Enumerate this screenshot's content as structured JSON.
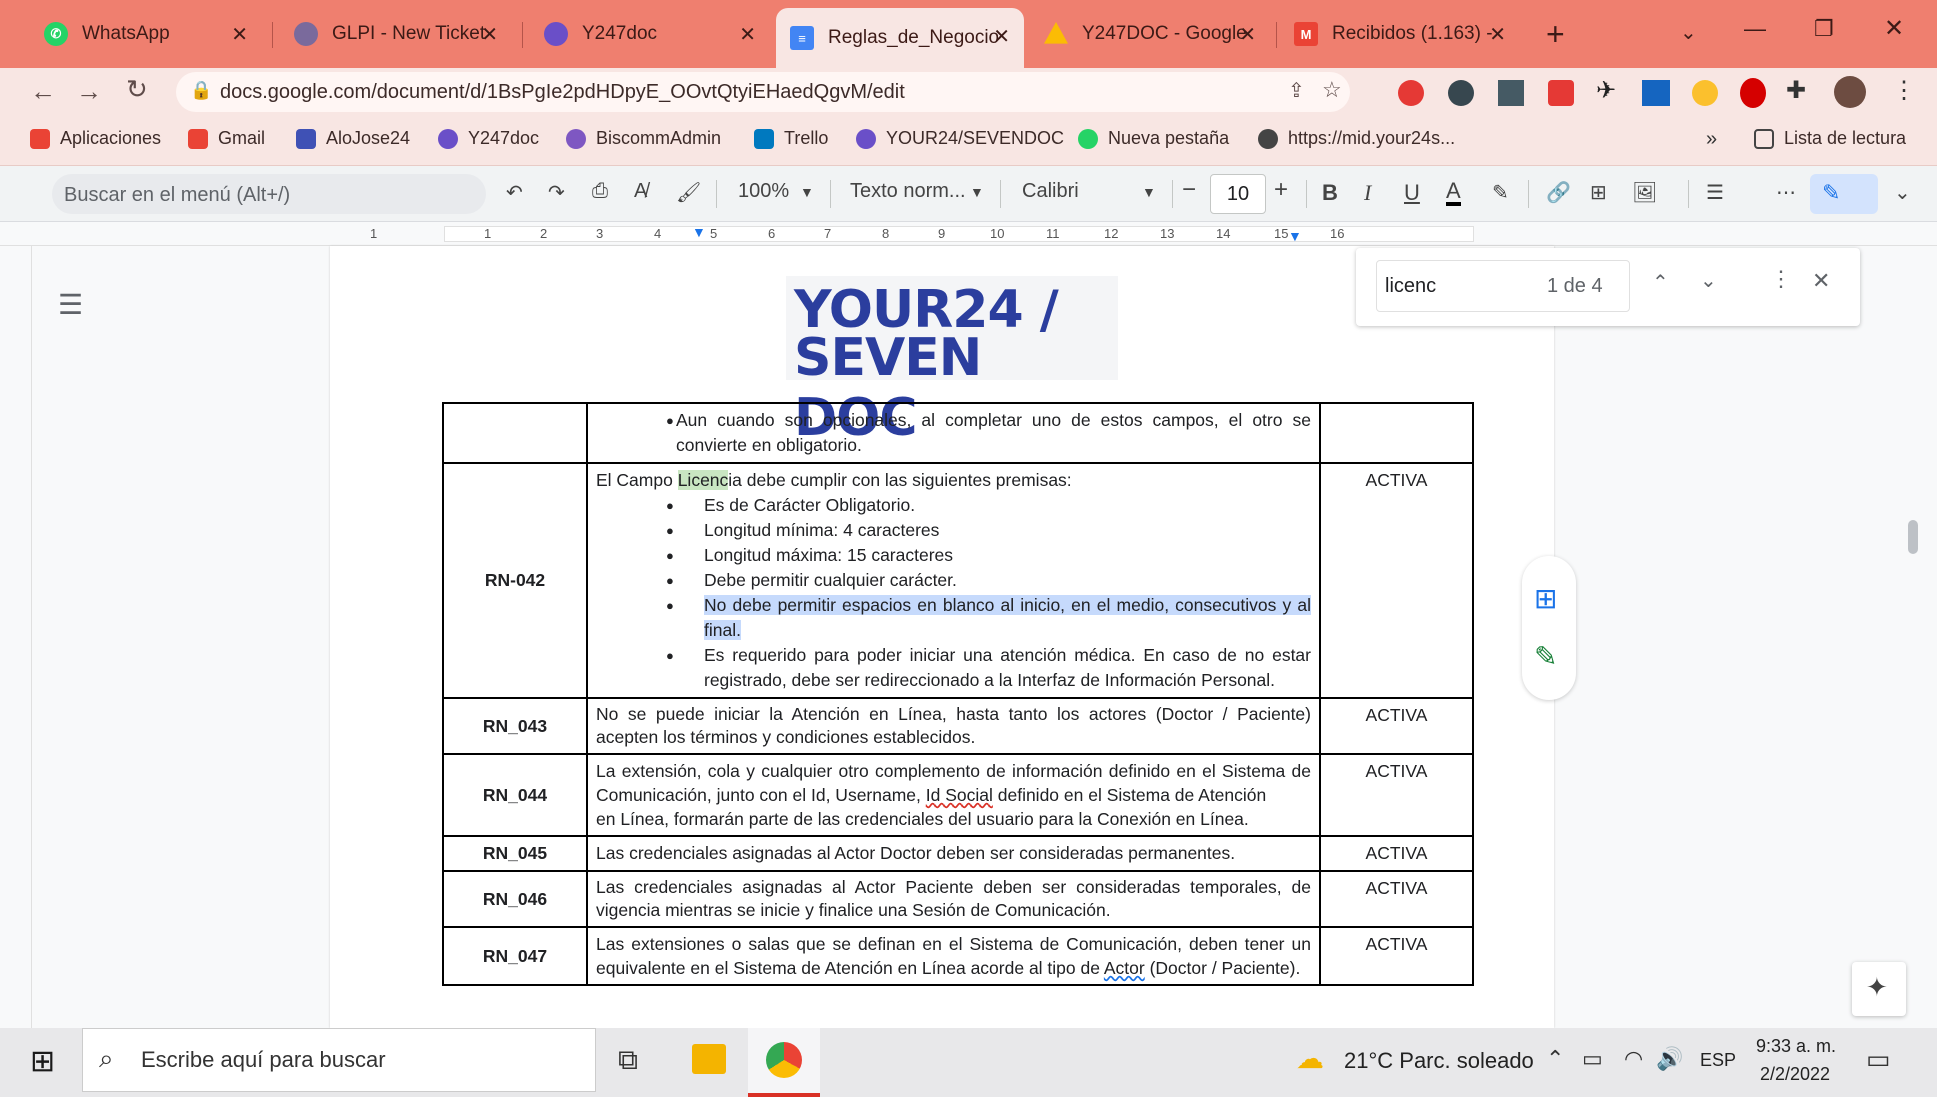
{
  "browser": {
    "tabs": [
      {
        "label": "WhatsApp",
        "icon": "whatsapp-icon",
        "color": "#25d366"
      },
      {
        "label": "GLPI - New Ticket",
        "icon": "glpi-icon",
        "color": "#7a6a9c"
      },
      {
        "label": "Y247doc",
        "icon": "y247-icon",
        "color": "#6a4fc8"
      },
      {
        "label": "Reglas_de_Negocio",
        "icon": "google-docs-icon",
        "color": "#4285f4"
      },
      {
        "label": "Y247DOC - Google",
        "icon": "google-drive-icon",
        "color": "#fbbc04"
      },
      {
        "label": "Recibidos (1.163) -",
        "icon": "gmail-icon",
        "color": "#ea4335"
      }
    ],
    "url": "docs.google.com/document/d/1BsPgIe2pdHDpyE_OOvtQtyiEHaedQgvM/edit",
    "bookmarks": [
      {
        "label": "Aplicaciones",
        "icon": "apps-grid-icon",
        "color": "#ea4335"
      },
      {
        "label": "Gmail",
        "icon": "gmail-icon",
        "color": "#ea4335"
      },
      {
        "label": "AloJose24",
        "icon": "alojose-icon",
        "color": "#3f51b5"
      },
      {
        "label": "Y247doc",
        "icon": "y247-icon",
        "color": "#6a4fc8"
      },
      {
        "label": "BiscommAdmin",
        "icon": "biscomm-icon",
        "color": "#7e57c2"
      },
      {
        "label": "Trello",
        "icon": "trello-icon",
        "color": "#0079bf"
      },
      {
        "label": "YOUR24/SEVENDOC",
        "icon": "y247-icon",
        "color": "#6a4fc8"
      },
      {
        "label": "Nueva pestaña",
        "icon": "whatsapp-icon",
        "color": "#25d366"
      },
      {
        "label": "https://mid.your24s...",
        "icon": "globe-icon",
        "color": "#444"
      }
    ],
    "reading_list": "Lista de lectura"
  },
  "docs_toolbar": {
    "menu_search_placeholder": "Buscar en el menú (Alt+/)",
    "zoom": "100%",
    "style": "Texto norm...",
    "font": "Calibri",
    "font_size": "10"
  },
  "ruler": [
    "1",
    "1",
    "2",
    "3",
    "4",
    "5",
    "6",
    "7",
    "8",
    "9",
    "10",
    "11",
    "12",
    "13",
    "14",
    "15",
    "16"
  ],
  "find": {
    "query": "licenc",
    "count": "1 de 4"
  },
  "logo": {
    "line1": "YOUR24 /",
    "line2": "SEVEN DOC"
  },
  "table": {
    "row0": {
      "bullet": "Aun cuando son opcionales, al completar uno de estos campos, el otro se convierte en obligatorio."
    },
    "row1": {
      "id": "RN-042",
      "intro_pre": "El Campo ",
      "intro_match": "Licenc",
      "intro_post": "ia debe cumplir con las siguientes premisas:",
      "bullets": [
        "Es de Carácter Obligatorio.",
        "Longitud mínima: 4 caracteres",
        "Longitud máxima: 15 caracteres",
        "Debe permitir cualquier carácter."
      ],
      "selected": "No debe permitir espacios en blanco al inicio, en el medio, consecutivos y al final.",
      "last": "Es requerido para poder iniciar una atención médica. En caso de no estar registrado, debe ser redireccionado a la Interfaz de Información Personal.",
      "status": "ACTIVA"
    },
    "row2": {
      "id": "RN_043",
      "text": "No se puede iniciar la Atención en Línea, hasta tanto los actores (Doctor / Paciente) acepten los términos y condiciones establecidos.",
      "status": "ACTIVA"
    },
    "row3": {
      "id": "RN_044",
      "pre": "La extensión, cola y cualquier otro complemento de información definido en el Sistema de Comunicación, junto con el Id, Username, ",
      "squig": "Id Social",
      "post": " definido en el Sistema de Atención",
      "line2": "en Línea, formarán parte de las credenciales del usuario para la Conexión en Línea.",
      "status": "ACTIVA"
    },
    "row4": {
      "id": "RN_045",
      "text": "Las credenciales asignadas al Actor Doctor deben ser consideradas permanentes.",
      "status": "ACTIVA"
    },
    "row5": {
      "id": "RN_046",
      "text": "Las credenciales asignadas al Actor Paciente deben ser consideradas temporales, de vigencia mientras se inicie y finalice una Sesión de Comunicación.",
      "status": "ACTIVA"
    },
    "row6": {
      "id": "RN_047",
      "pre": "Las extensiones o salas que se definan en el Sistema de Comunicación, deben tener un equivalente en el Sistema de Atención en Línea acorde al tipo de ",
      "squig": "Actor",
      "post": " (Doctor / Paciente).",
      "status": "ACTIVA"
    }
  },
  "taskbar": {
    "search_placeholder": "Escribe aquí para buscar",
    "weather": "21°C  Parc. soleado",
    "lang": "ESP",
    "time": "9:33 a. m.",
    "date": "2/2/2022"
  }
}
